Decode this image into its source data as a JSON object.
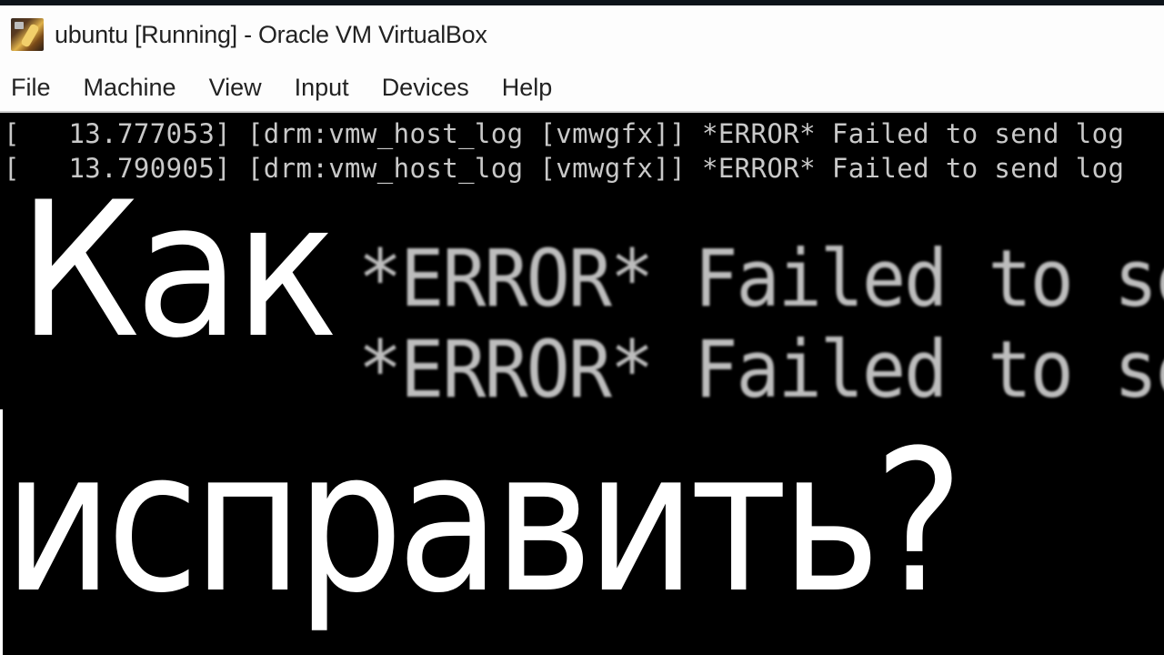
{
  "window": {
    "title": "ubuntu [Running] - Oracle VM VirtualBox",
    "icon": "virtualbox-icon"
  },
  "menubar": {
    "items": [
      {
        "label": "File"
      },
      {
        "label": "Machine"
      },
      {
        "label": "View"
      },
      {
        "label": "Input"
      },
      {
        "label": "Devices"
      },
      {
        "label": "Help"
      }
    ]
  },
  "console": {
    "lines": [
      {
        "text": "[   13.777053] [drm:vmw_host_log [vmwgfx]] *ERROR* Failed to send log"
      },
      {
        "text": "[   13.790905] [drm:vmw_host_log [vmwgfx]] *ERROR* Failed to send log"
      }
    ],
    "zoomed_lines": [
      {
        "text": "*ERROR* Failed to send log"
      },
      {
        "text": "*ERROR* Failed to send log"
      }
    ]
  },
  "overlay": {
    "line1": "Как",
    "line2": "исправить?"
  },
  "colors": {
    "background": "#000000",
    "console_text": "#c9c9c9",
    "overlay_text": "#ffffff",
    "titlebar": "#fdfdfd"
  }
}
